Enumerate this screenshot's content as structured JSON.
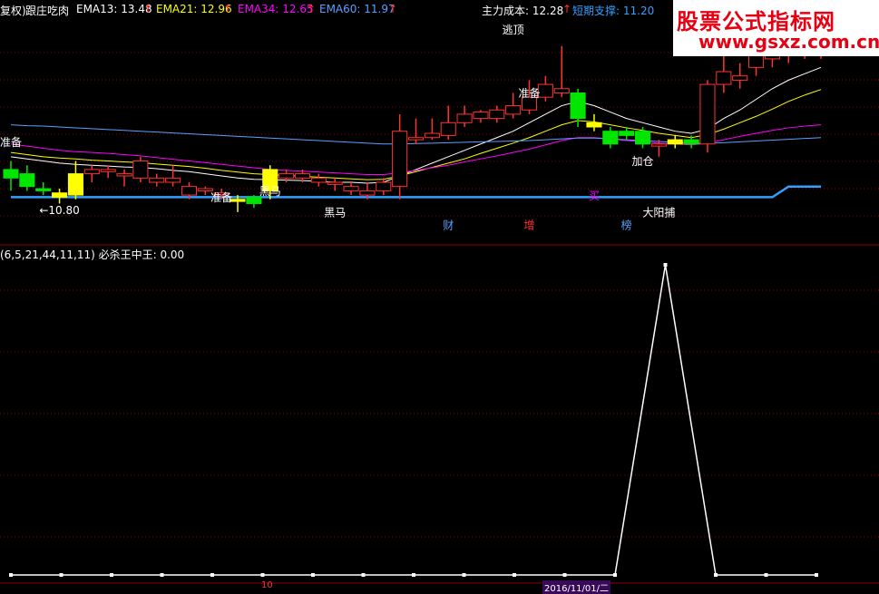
{
  "header": {
    "prefix": "复权)",
    "indicator_name": "跟庄吃肉",
    "ema13": "EMA13: 13.48",
    "ema21": "EMA21: 12.96",
    "ema34": "EMA34: 12.65",
    "ema60": "EMA60: 11.97",
    "arrow": "↑",
    "main_cost": "主力成本: 12.28",
    "short_support": "短期支撑: 11.20"
  },
  "watermark": {
    "title": "股票公式指标网",
    "url": "www.gsxz.com.cn"
  },
  "lower_header": "(6,5,21,44,11,11)  必杀王中王: 0.00",
  "bottom_axis": {
    "left_tick": "10",
    "date": "2016/11/01/二"
  },
  "colors": {
    "up": "#ff3232",
    "down": "#00e600",
    "yellow": "#ffff00",
    "ema13": "#ffffff",
    "ema21": "#ffff00",
    "ema34": "#ff00ff",
    "ema60": "#5aa0ff",
    "support": "#32a0ff",
    "grid": "#8b0000"
  },
  "chart_data": [
    {
      "type": "candlestick",
      "title": "跟庄吃肉",
      "price_range": [
        10.0,
        15.2
      ],
      "candles": [
        {
          "o": 11.4,
          "h": 11.8,
          "l": 11.1,
          "c": 11.6,
          "color": "green"
        },
        {
          "o": 11.5,
          "h": 11.7,
          "l": 11.1,
          "c": 11.2,
          "color": "green"
        },
        {
          "o": 11.15,
          "h": 11.3,
          "l": 11.0,
          "c": 11.1,
          "color": "green"
        },
        {
          "o": 11.05,
          "h": 11.15,
          "l": 10.8,
          "c": 10.95,
          "color": "yellow"
        },
        {
          "o": 11.0,
          "h": 11.8,
          "l": 10.9,
          "c": 11.5,
          "color": "yellow"
        },
        {
          "o": 11.5,
          "h": 11.7,
          "l": 11.3,
          "c": 11.6,
          "color": "red"
        },
        {
          "o": 11.6,
          "h": 11.7,
          "l": 11.4,
          "c": 11.55,
          "color": "red"
        },
        {
          "o": 11.5,
          "h": 11.6,
          "l": 11.2,
          "c": 11.45,
          "color": "red"
        },
        {
          "o": 11.4,
          "h": 11.9,
          "l": 11.3,
          "c": 11.8,
          "color": "red"
        },
        {
          "o": 11.4,
          "h": 11.5,
          "l": 11.2,
          "c": 11.3,
          "color": "red"
        },
        {
          "o": 11.3,
          "h": 11.7,
          "l": 11.2,
          "c": 11.4,
          "color": "red"
        },
        {
          "o": 11.2,
          "h": 11.3,
          "l": 10.9,
          "c": 11.0,
          "color": "red"
        },
        {
          "o": 11.1,
          "h": 11.2,
          "l": 11.0,
          "c": 11.15,
          "color": "red"
        },
        {
          "o": 11.05,
          "h": 11.15,
          "l": 10.9,
          "c": 11.0,
          "color": "red"
        },
        {
          "o": 10.9,
          "h": 11.0,
          "l": 10.6,
          "c": 10.85,
          "color": "yellow"
        },
        {
          "o": 10.8,
          "h": 11.0,
          "l": 10.7,
          "c": 10.95,
          "color": "green"
        },
        {
          "o": 11.1,
          "h": 11.7,
          "l": 10.9,
          "c": 11.6,
          "color": "yellow"
        },
        {
          "o": 11.4,
          "h": 11.6,
          "l": 11.3,
          "c": 11.5,
          "color": "red"
        },
        {
          "o": 11.4,
          "h": 11.6,
          "l": 11.3,
          "c": 11.5,
          "color": "red"
        },
        {
          "o": 11.4,
          "h": 11.5,
          "l": 11.2,
          "c": 11.3,
          "color": "red"
        },
        {
          "o": 11.3,
          "h": 11.4,
          "l": 11.1,
          "c": 11.25,
          "color": "red"
        },
        {
          "o": 11.1,
          "h": 11.3,
          "l": 11.0,
          "c": 11.2,
          "color": "red"
        },
        {
          "o": 11.0,
          "h": 11.3,
          "l": 10.9,
          "c": 11.1,
          "color": "red"
        },
        {
          "o": 11.1,
          "h": 11.4,
          "l": 11.0,
          "c": 11.3,
          "color": "red"
        },
        {
          "o": 11.2,
          "h": 12.9,
          "l": 10.9,
          "c": 12.5,
          "color": "red"
        },
        {
          "o": 12.3,
          "h": 12.8,
          "l": 12.2,
          "c": 12.35,
          "color": "red"
        },
        {
          "o": 12.35,
          "h": 12.8,
          "l": 12.3,
          "c": 12.45,
          "color": "red"
        },
        {
          "o": 12.4,
          "h": 13.1,
          "l": 12.3,
          "c": 12.7,
          "color": "red"
        },
        {
          "o": 12.7,
          "h": 13.1,
          "l": 12.6,
          "c": 12.9,
          "color": "red"
        },
        {
          "o": 12.8,
          "h": 13.0,
          "l": 12.7,
          "c": 12.95,
          "color": "red"
        },
        {
          "o": 12.8,
          "h": 13.1,
          "l": 12.7,
          "c": 13.0,
          "color": "red"
        },
        {
          "o": 12.9,
          "h": 13.4,
          "l": 12.8,
          "c": 13.1,
          "color": "red"
        },
        {
          "o": 13.0,
          "h": 13.7,
          "l": 12.9,
          "c": 13.3,
          "color": "red"
        },
        {
          "o": 13.3,
          "h": 13.8,
          "l": 13.2,
          "c": 13.6,
          "color": "red"
        },
        {
          "o": 13.4,
          "h": 14.5,
          "l": 13.3,
          "c": 13.5,
          "color": "red"
        },
        {
          "o": 13.4,
          "h": 13.5,
          "l": 12.6,
          "c": 12.8,
          "color": "green"
        },
        {
          "o": 12.7,
          "h": 12.9,
          "l": 12.5,
          "c": 12.6,
          "color": "yellow"
        },
        {
          "o": 12.5,
          "h": 12.6,
          "l": 12.1,
          "c": 12.2,
          "color": "green"
        },
        {
          "o": 12.5,
          "h": 12.6,
          "l": 12.3,
          "c": 12.4,
          "color": "green"
        },
        {
          "o": 12.5,
          "h": 12.6,
          "l": 12.1,
          "c": 12.2,
          "color": "green"
        },
        {
          "o": 12.2,
          "h": 12.3,
          "l": 11.9,
          "c": 12.15,
          "color": "red"
        },
        {
          "o": 12.2,
          "h": 12.4,
          "l": 12.1,
          "c": 12.3,
          "color": "yellow"
        },
        {
          "o": 12.3,
          "h": 12.4,
          "l": 12.1,
          "c": 12.2,
          "color": "green"
        },
        {
          "o": 12.2,
          "h": 13.7,
          "l": 12.0,
          "c": 13.6,
          "color": "red"
        },
        {
          "o": 13.6,
          "h": 14.6,
          "l": 13.4,
          "c": 13.9,
          "color": "red"
        },
        {
          "o": 13.7,
          "h": 14.1,
          "l": 13.5,
          "c": 13.8,
          "color": "red"
        },
        {
          "o": 14.0,
          "h": 14.9,
          "l": 13.8,
          "c": 14.6,
          "color": "red"
        },
        {
          "o": 14.2,
          "h": 14.9,
          "l": 14.0,
          "c": 14.6,
          "color": "red"
        },
        {
          "o": 14.3,
          "h": 14.8,
          "l": 14.1,
          "c": 14.6,
          "color": "red"
        },
        {
          "o": 14.4,
          "h": 14.7,
          "l": 14.2,
          "c": 14.5,
          "color": "red"
        },
        {
          "o": 14.3,
          "h": 14.6,
          "l": 14.2,
          "c": 14.4,
          "color": "red"
        }
      ],
      "series": [
        {
          "name": "EMA13",
          "color": "#ffffff",
          "values": [
            11.9,
            11.85,
            11.8,
            11.75,
            11.72,
            11.7,
            11.68,
            11.66,
            11.65,
            11.62,
            11.58,
            11.55,
            11.5,
            11.45,
            11.4,
            11.37,
            11.36,
            11.35,
            11.34,
            11.32,
            11.3,
            11.3,
            11.28,
            11.3,
            11.45,
            11.6,
            11.75,
            11.9,
            12.05,
            12.2,
            12.35,
            12.5,
            12.7,
            12.9,
            13.1,
            13.2,
            13.1,
            12.95,
            12.8,
            12.7,
            12.6,
            12.5,
            12.45,
            12.55,
            12.8,
            13.0,
            13.25,
            13.5,
            13.7,
            13.85,
            14.0
          ]
        },
        {
          "name": "EMA21",
          "color": "#ffff00",
          "values": [
            12.0,
            11.95,
            11.9,
            11.87,
            11.85,
            11.82,
            11.8,
            11.78,
            11.76,
            11.73,
            11.7,
            11.67,
            11.63,
            11.58,
            11.54,
            11.5,
            11.48,
            11.46,
            11.44,
            11.42,
            11.4,
            11.38,
            11.36,
            11.37,
            11.45,
            11.55,
            11.65,
            11.75,
            11.85,
            11.98,
            12.1,
            12.22,
            12.35,
            12.5,
            12.65,
            12.75,
            12.72,
            12.65,
            12.58,
            12.52,
            12.45,
            12.4,
            12.35,
            12.42,
            12.55,
            12.7,
            12.85,
            13.02,
            13.2,
            13.35,
            13.48
          ]
        },
        {
          "name": "EMA34",
          "color": "#ff00ff",
          "values": [
            12.2,
            12.15,
            12.1,
            12.05,
            12.02,
            12.0,
            11.98,
            11.95,
            11.92,
            11.88,
            11.84,
            11.8,
            11.76,
            11.72,
            11.68,
            11.64,
            11.6,
            11.58,
            11.56,
            11.54,
            11.52,
            11.5,
            11.48,
            11.48,
            11.52,
            11.58,
            11.64,
            11.7,
            11.78,
            11.85,
            11.92,
            12.0,
            12.08,
            12.18,
            12.28,
            12.35,
            12.35,
            12.32,
            12.28,
            12.25,
            12.22,
            12.2,
            12.18,
            12.22,
            12.3,
            12.38,
            12.45,
            12.52,
            12.58,
            12.62,
            12.65
          ]
        },
        {
          "name": "EMA60",
          "color": "#5aa0ff",
          "values": [
            12.65,
            12.63,
            12.62,
            12.6,
            12.58,
            12.56,
            12.54,
            12.52,
            12.5,
            12.48,
            12.46,
            12.44,
            12.42,
            12.4,
            12.38,
            12.36,
            12.34,
            12.32,
            12.3,
            12.28,
            12.26,
            12.24,
            12.22,
            12.2,
            12.2,
            12.21,
            12.22,
            12.23,
            12.24,
            12.25,
            12.26,
            12.27,
            12.28,
            12.3,
            12.32,
            12.34,
            12.34,
            12.32,
            12.3,
            12.28,
            12.26,
            12.24,
            12.22,
            12.22,
            12.23,
            12.25,
            12.27,
            12.29,
            12.31,
            12.33,
            12.35
          ]
        }
      ],
      "support_line": [
        10.95,
        10.95,
        10.95,
        10.95,
        10.95,
        10.95,
        10.95,
        10.95,
        10.95,
        10.95,
        10.95,
        10.95,
        10.95,
        10.95,
        10.95,
        10.95,
        10.95,
        10.95,
        10.95,
        10.95,
        10.95,
        10.95,
        10.95,
        10.95,
        10.95,
        10.95,
        10.95,
        10.95,
        10.95,
        10.95,
        10.95,
        10.95,
        10.95,
        10.95,
        10.95,
        10.95,
        10.95,
        10.95,
        10.95,
        10.95,
        10.95,
        10.95,
        10.95,
        10.95,
        10.95,
        10.95,
        10.95,
        10.95,
        11.2,
        11.2,
        11.2
      ],
      "annotations": [
        {
          "text": "准备",
          "i": 0,
          "p": 12.15,
          "color": "#ffffff"
        },
        {
          "text": "←10.80",
          "i": 3,
          "p": 10.55,
          "color": "#ffffff"
        },
        {
          "text": "准备",
          "i": 13,
          "p": 10.85,
          "color": "#ffffff"
        },
        {
          "text": "黑马",
          "i": 16,
          "p": 11.0,
          "color": "#ffffff"
        },
        {
          "text": "黑马",
          "i": 20,
          "p": 10.5,
          "color": "#ffffff"
        },
        {
          "text": "逃顶",
          "i": 31,
          "p": 14.8,
          "color": "#ffffff"
        },
        {
          "text": "准备",
          "i": 32,
          "p": 13.3,
          "color": "#ffffff"
        },
        {
          "text": "买",
          "i": 36,
          "p": 10.9,
          "color": "#ff00ff"
        },
        {
          "text": "加仓",
          "i": 39,
          "p": 11.7,
          "color": "#ffffff"
        },
        {
          "text": "财",
          "i": 27,
          "p": 10.2,
          "color": "#5aa0ff"
        },
        {
          "text": "增",
          "i": 32,
          "p": 10.2,
          "color": "#ff3232"
        },
        {
          "text": "榜",
          "i": 38,
          "p": 10.2,
          "color": "#5aa0ff"
        },
        {
          "text": "大阳捕",
          "i": 40,
          "p": 10.5,
          "color": "#ffffff"
        }
      ]
    },
    {
      "type": "line",
      "title": "必杀王中王",
      "ylim": [
        0,
        1
      ],
      "values": [
        0,
        0,
        0,
        0,
        0,
        0,
        0,
        0,
        0,
        0,
        0,
        0,
        0,
        1,
        0,
        0,
        0
      ]
    }
  ]
}
